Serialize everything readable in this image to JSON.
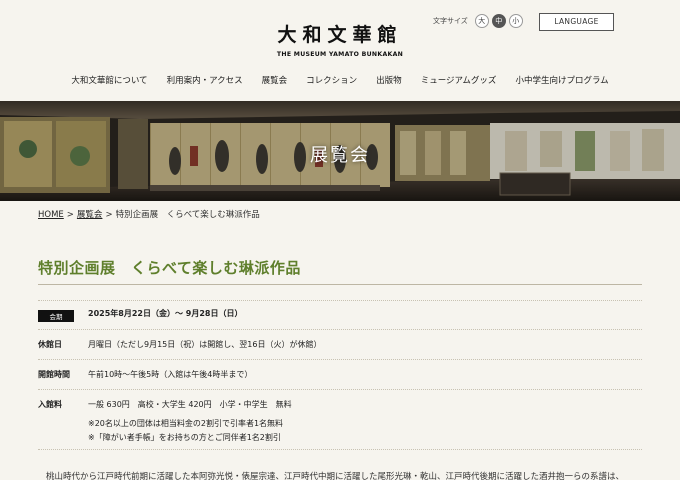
{
  "header": {
    "logo_jp": "大和文華館",
    "logo_en": "THE MUSEUM YAMATO BUNKAKAN",
    "font_size_label": "文字サイズ",
    "font_sizes": [
      "大",
      "中",
      "小"
    ],
    "language_label": "LANGUAGE"
  },
  "nav": {
    "items": [
      "大和文華館について",
      "利用案内・アクセス",
      "展覧会",
      "コレクション",
      "出版物",
      "ミュージアムグッズ",
      "小中学生向けプログラム"
    ]
  },
  "hero": {
    "title": "展覧会"
  },
  "breadcrumb": {
    "home": "HOME",
    "exhibitions": "展覧会",
    "current": "特別企画展　くらべて楽しむ琳派作品",
    "separator": ">"
  },
  "page": {
    "title": "特別企画展　くらべて楽しむ琳派作品"
  },
  "info": {
    "period_label": "会期",
    "period_value": "2025年8月22日（金）～ 9月28日（日）",
    "closed_label": "休館日",
    "closed_value": "月曜日（ただし9月15日（祝）は開館し、翌16日（火）が休館）",
    "hours_label": "開館時間",
    "hours_value": "午前10時～午後5時（入館は午後4時半まで）",
    "fee_label": "入館料",
    "fee_value": "一般 630円　高校・大学生 420円　小学・中学生　無料",
    "fee_note1": "※20名以上の団体は相当料金の2割引で引率者1名無料",
    "fee_note2": "※「障がい者手帳」をお持ちの方とご同伴者1名2割引"
  },
  "body": {
    "intro": "桃山時代から江戸時代前期に活躍した本阿弥光悦・俵屋宗達、江戸時代中期に活躍した尾形光琳・乾山、江戸時代後期に活躍した酒井抱一らの系譜は、"
  }
}
